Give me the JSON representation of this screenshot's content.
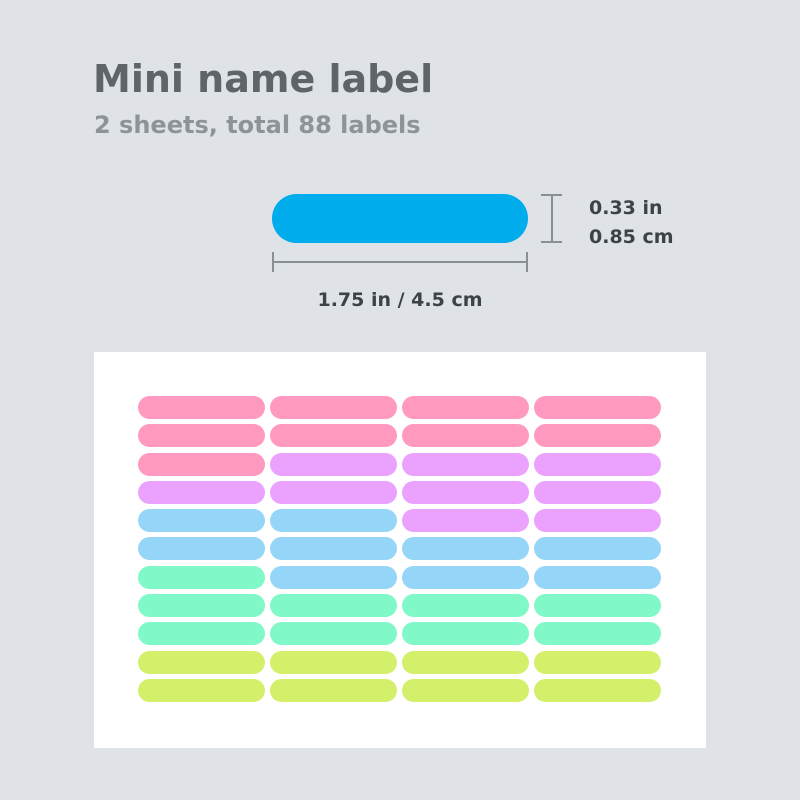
{
  "header": {
    "title": "Mini name label",
    "subtitle": "2 sheets, total 88 labels"
  },
  "sample": {
    "color": "#00acec",
    "height_in": "0.33 in",
    "height_cm": "0.85 cm",
    "width_text": "1.75 in / 4.5 cm"
  },
  "sheet": {
    "columns": 4,
    "rows": 11,
    "cells": [
      "#ff99bf",
      "#ff99bf",
      "#ff99bf",
      "#ff99bf",
      "#ff99bf",
      "#ff99bf",
      "#ff99bf",
      "#ff99bf",
      "#ff99bf",
      "#eba2ff",
      "#eba2ff",
      "#eba2ff",
      "#eba2ff",
      "#eba2ff",
      "#eba2ff",
      "#eba2ff",
      "#95d5f8",
      "#95d5f8",
      "#eba2ff",
      "#eba2ff",
      "#95d5f8",
      "#95d5f8",
      "#95d5f8",
      "#95d5f8",
      "#81f8c8",
      "#95d5f8",
      "#95d5f8",
      "#95d5f8",
      "#81f8c8",
      "#81f8c8",
      "#81f8c8",
      "#81f8c8",
      "#81f8c8",
      "#81f8c8",
      "#81f8c8",
      "#81f8c8",
      "#d4f06b",
      "#d4f06b",
      "#d4f06b",
      "#d4f06b",
      "#d4f06b",
      "#d4f06b",
      "#d4f06b",
      "#d4f06b"
    ]
  }
}
